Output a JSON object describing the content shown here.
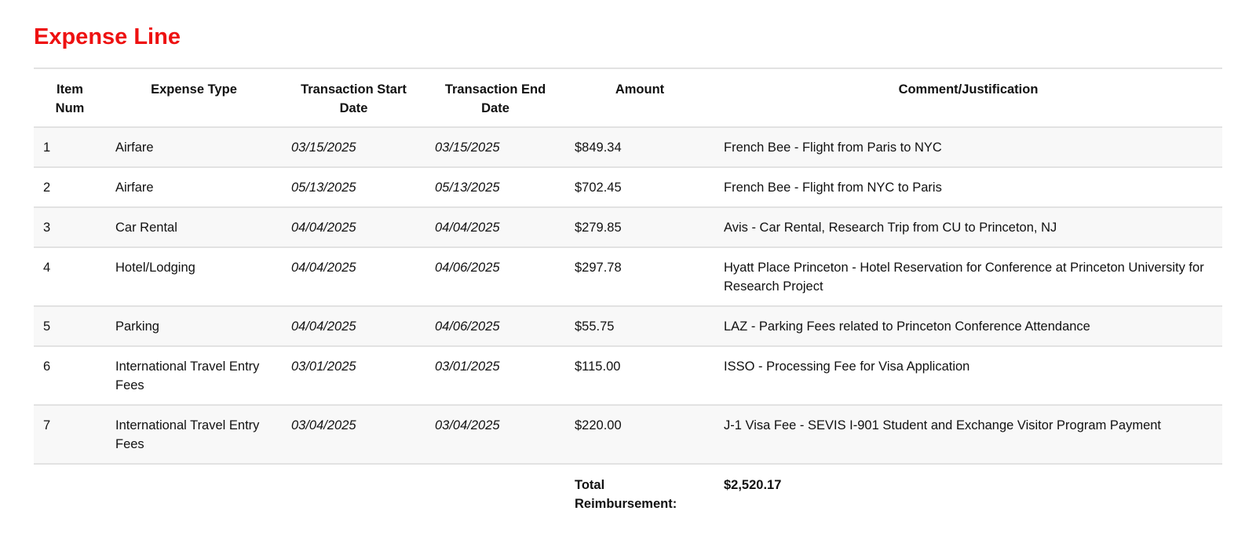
{
  "title": "Expense Line",
  "colors": {
    "title": "#ee1111",
    "row_shade": "#f8f8f8",
    "border": "#e2e2e2"
  },
  "table": {
    "headers": {
      "item_num": "Item Num",
      "expense_type": "Expense Type",
      "start_date": "Transaction Start Date",
      "end_date": "Transaction End Date",
      "amount": "Amount",
      "comment": "Comment/Justification"
    },
    "rows": [
      {
        "item": "1",
        "type": "Airfare",
        "start": "03/15/2025",
        "end": "03/15/2025",
        "amount": "$849.34",
        "comment": "French Bee - Flight from Paris to NYC"
      },
      {
        "item": "2",
        "type": "Airfare",
        "start": "05/13/2025",
        "end": "05/13/2025",
        "amount": "$702.45",
        "comment": "French Bee - Flight from NYC to Paris"
      },
      {
        "item": "3",
        "type": "Car Rental",
        "start": "04/04/2025",
        "end": "04/04/2025",
        "amount": "$279.85",
        "comment": "Avis - Car Rental, Research Trip from CU to Princeton, NJ"
      },
      {
        "item": "4",
        "type": "Hotel/Lodging",
        "start": "04/04/2025",
        "end": "04/06/2025",
        "amount": "$297.78",
        "comment": "Hyatt Place Princeton - Hotel Reservation for Conference at Princeton University for Research Project"
      },
      {
        "item": "5",
        "type": "Parking",
        "start": "04/04/2025",
        "end": "04/06/2025",
        "amount": "$55.75",
        "comment": "LAZ - Parking Fees related to Princeton Conference Attendance"
      },
      {
        "item": "6",
        "type": "International Travel Entry Fees",
        "start": "03/01/2025",
        "end": "03/01/2025",
        "amount": "$115.00",
        "comment": "ISSO - Processing Fee for Visa Application"
      },
      {
        "item": "7",
        "type": "International Travel Entry Fees",
        "start": "03/04/2025",
        "end": "03/04/2025",
        "amount": "$220.00",
        "comment": "J-1 Visa Fee - SEVIS I-901 Student and Exchange Visitor Program Payment"
      }
    ],
    "total_label": "Total Reimbursement:",
    "total_value": "$2,520.17"
  }
}
